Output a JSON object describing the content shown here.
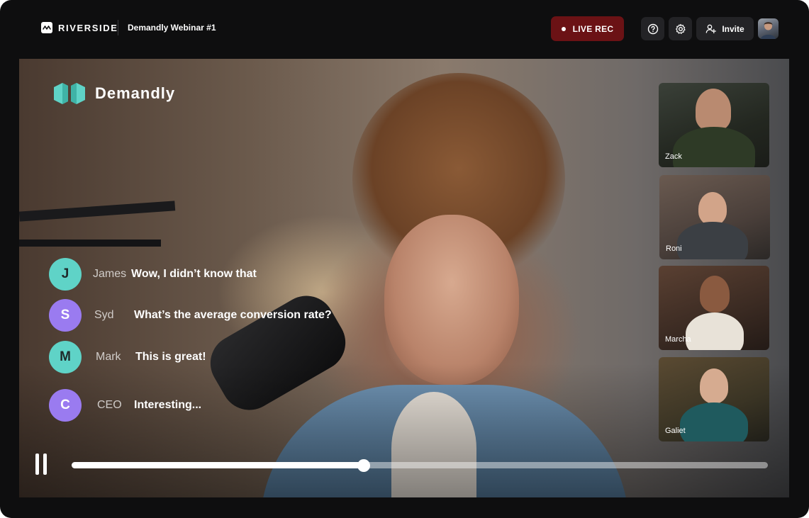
{
  "app": {
    "brand": "RIVERSIDE",
    "project_title": "Demandly Webinar #1"
  },
  "header": {
    "live_rec_label": "LIVE REC",
    "live_rec_color": "#6b1215",
    "invite_label": "Invite",
    "icons": [
      "help-icon",
      "gear-icon",
      "add-user-icon"
    ]
  },
  "stage": {
    "logo_name": "Demandly",
    "logo_color": "#5fd3c7"
  },
  "chat": {
    "messages": [
      {
        "initial": "J",
        "name": "James",
        "text": "Wow, I didn’t know that",
        "color": "#5fd3c7"
      },
      {
        "initial": "S",
        "name": "Syd",
        "text": "What’s the average conversion rate?",
        "color": "#9a7bf0"
      },
      {
        "initial": "M",
        "name": "Mark",
        "text": "This is great!",
        "color": "#5fd3c7"
      },
      {
        "initial": "C",
        "name": "CEO",
        "text": "Interesting...",
        "color": "#9a7bf0"
      }
    ]
  },
  "participants": [
    {
      "name": "Zack"
    },
    {
      "name": "Roni"
    },
    {
      "name": "Marcha"
    },
    {
      "name": "Galiet"
    }
  ],
  "playback": {
    "state": "playing",
    "progress": 0.42
  }
}
